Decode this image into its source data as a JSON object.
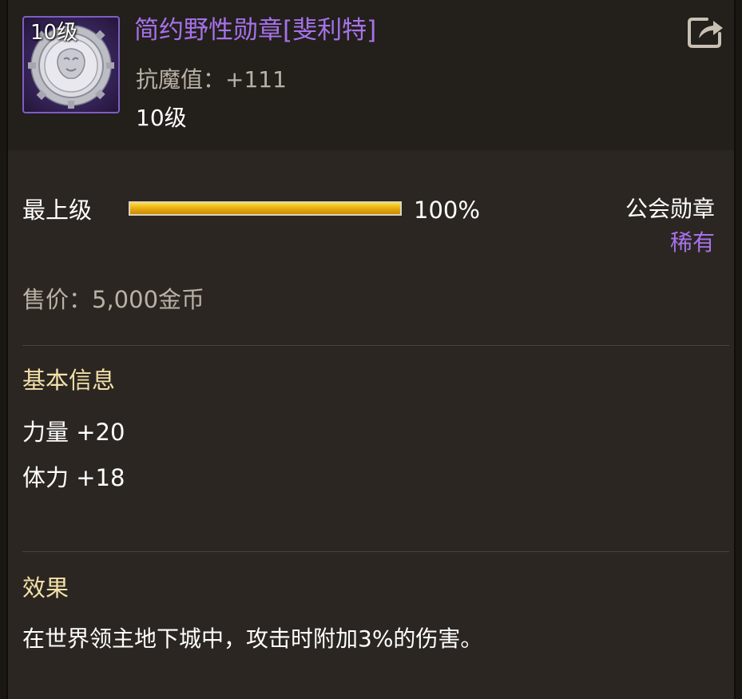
{
  "item": {
    "icon_name": "lion-medal-icon",
    "level_badge": "10级",
    "name": "简约野性勋章[斐利特]",
    "stat": "抗魔值：+111",
    "level": "10级",
    "name_color": "#a672ea"
  },
  "share_icon": "share-export-icon",
  "upgrade": {
    "label": "最上级",
    "progress_percent": 100,
    "progress_text": "100%"
  },
  "category": "公会勋章",
  "rarity": "稀有",
  "price": "售价：5,000金币",
  "basic_info": {
    "title": "基本信息",
    "attributes": [
      "力量 +20",
      "体力 +18"
    ]
  },
  "effect": {
    "title": "效果",
    "text": "在世界领主地下城中，攻击时附加3%的伤害。"
  }
}
